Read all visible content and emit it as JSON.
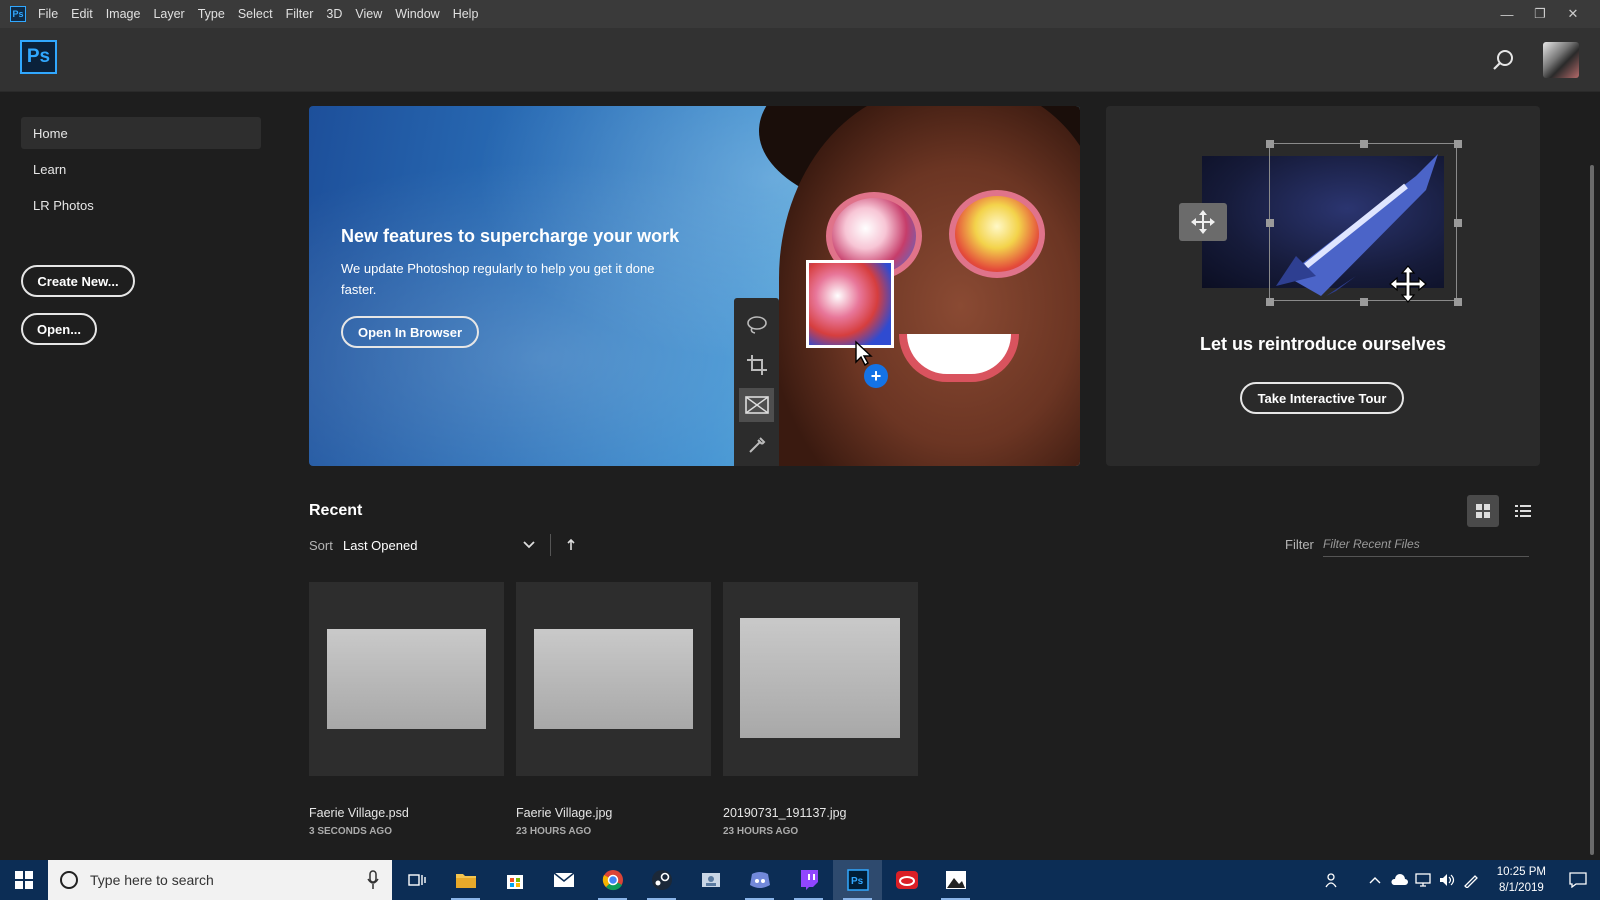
{
  "menubar": {
    "app_icon": "Ps",
    "items": [
      "File",
      "Edit",
      "Image",
      "Layer",
      "Type",
      "Select",
      "Filter",
      "3D",
      "View",
      "Window",
      "Help"
    ]
  },
  "header": {
    "logo": "Ps",
    "search_icon": "search-icon",
    "avatar": "user-avatar"
  },
  "sidebar": {
    "items": [
      {
        "label": "Home",
        "active": true
      },
      {
        "label": "Learn",
        "active": false
      },
      {
        "label": "LR Photos",
        "active": false
      }
    ],
    "create_new": "Create New...",
    "open": "Open..."
  },
  "hero": {
    "title": "New features to supercharge your work",
    "subtitle": "We update Photoshop regularly to help you get it done faster.",
    "cta": "Open In Browser",
    "tools": [
      "lasso-icon",
      "crop-icon",
      "frame-icon",
      "eyedropper-icon"
    ]
  },
  "tour": {
    "title": "Let us reintroduce ourselves",
    "cta": "Take Interactive Tour"
  },
  "recent": {
    "title": "Recent",
    "sort_label": "Sort",
    "sort_value": "Last Opened",
    "filter_label": "Filter",
    "filter_placeholder": "Filter Recent Files",
    "files": [
      {
        "name": "Faerie Village.psd",
        "time": "3 SECONDS AGO"
      },
      {
        "name": "Faerie Village.jpg",
        "time": "23 HOURS AGO"
      },
      {
        "name": "20190731_191137.jpg",
        "time": "23 HOURS AGO"
      }
    ]
  },
  "taskbar": {
    "search_placeholder": "Type here to search",
    "apps": [
      "task-view-icon",
      "file-explorer-icon",
      "store-icon",
      "mail-icon",
      "chrome-icon",
      "steam-icon",
      "contacts-icon",
      "discord-icon",
      "twitch-icon",
      "photoshop-icon",
      "creative-cloud-icon",
      "photos-icon"
    ],
    "time": "10:25 PM",
    "date": "8/1/2019"
  },
  "colors": {
    "accent": "#31a8ff",
    "taskbar": "#0c2d55",
    "background": "#1e1e1e"
  }
}
